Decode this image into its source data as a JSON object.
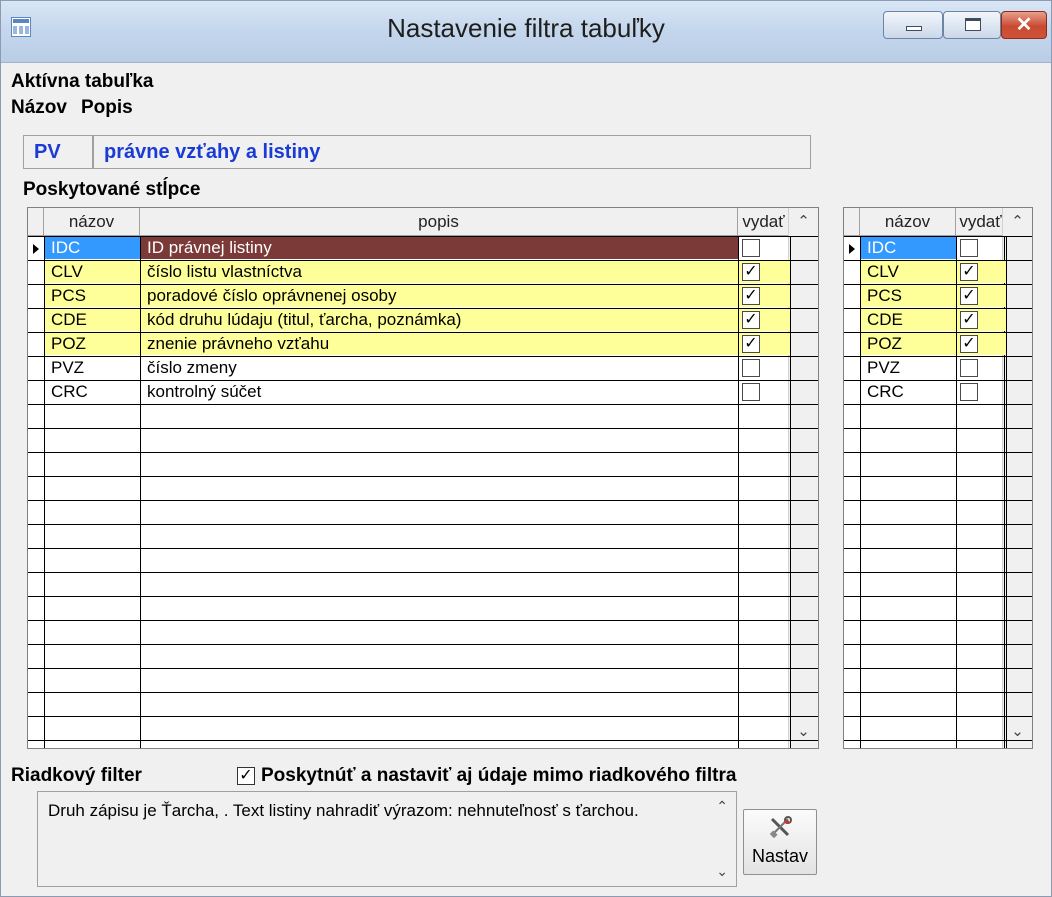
{
  "window": {
    "title": "Nastavenie filtra tabuľky",
    "close_glyph": "✕"
  },
  "active_table": {
    "heading": "Aktívna tabuľka",
    "name_label": "Názov",
    "desc_label": "Popis",
    "code": "PV",
    "description": "právne vzťahy a listiny"
  },
  "columns_section": {
    "heading": "Poskytované stĺpce",
    "main_grid": {
      "headers": [
        "názov",
        "popis",
        "vydať"
      ],
      "rows": [
        {
          "name": "IDC",
          "desc": "ID právnej listiny",
          "checked": false,
          "highlight": "current"
        },
        {
          "name": "CLV",
          "desc": "číslo listu vlastníctva",
          "checked": true,
          "highlight": "yellow"
        },
        {
          "name": "PCS",
          "desc": "poradové číslo oprávnenej osoby",
          "checked": true,
          "highlight": "yellow"
        },
        {
          "name": "CDE",
          "desc": "kód druhu lúdaju (titul, ťarcha, poznámka)",
          "checked": true,
          "highlight": "yellow"
        },
        {
          "name": "POZ",
          "desc": "znenie právneho vzťahu",
          "checked": true,
          "highlight": "yellow"
        },
        {
          "name": "PVZ",
          "desc": "číslo zmeny",
          "checked": false,
          "highlight": "none"
        },
        {
          "name": "CRC",
          "desc": "kontrolný súčet",
          "checked": false,
          "highlight": "none"
        }
      ]
    },
    "side_grid": {
      "headers": [
        "názov",
        "vydať"
      ],
      "rows": [
        {
          "name": "IDC",
          "checked": false,
          "highlight": "none"
        },
        {
          "name": "CLV",
          "checked": true,
          "highlight": "yellow"
        },
        {
          "name": "PCS",
          "checked": true,
          "highlight": "yellow"
        },
        {
          "name": "CDE",
          "checked": true,
          "highlight": "yellow"
        },
        {
          "name": "POZ",
          "checked": true,
          "highlight": "yellow"
        },
        {
          "name": "PVZ",
          "checked": false,
          "highlight": "none"
        },
        {
          "name": "CRC",
          "checked": false,
          "highlight": "none"
        }
      ]
    }
  },
  "row_filter": {
    "heading": "Riadkový filter",
    "checkbox_label": "Poskytnúť a nastaviť aj údaje mimo riadkového filtra",
    "checkbox_checked": true,
    "text": "Druh zápisu je Ťarcha, . Text listiny nahradiť výrazom: nehnuteľnosť s ťarchou.",
    "apply_button": "Nastav"
  },
  "icons": {
    "app": "table-icon",
    "apply": "tools-icon",
    "check": "✓",
    "scroll_up": "⌃",
    "scroll_down": "⌄"
  },
  "colors": {
    "highlight_yellow": "#ffff99",
    "current_cell": "#7b3a37",
    "selected_name": "#3399ff",
    "accent_text": "#1a3bd6"
  }
}
